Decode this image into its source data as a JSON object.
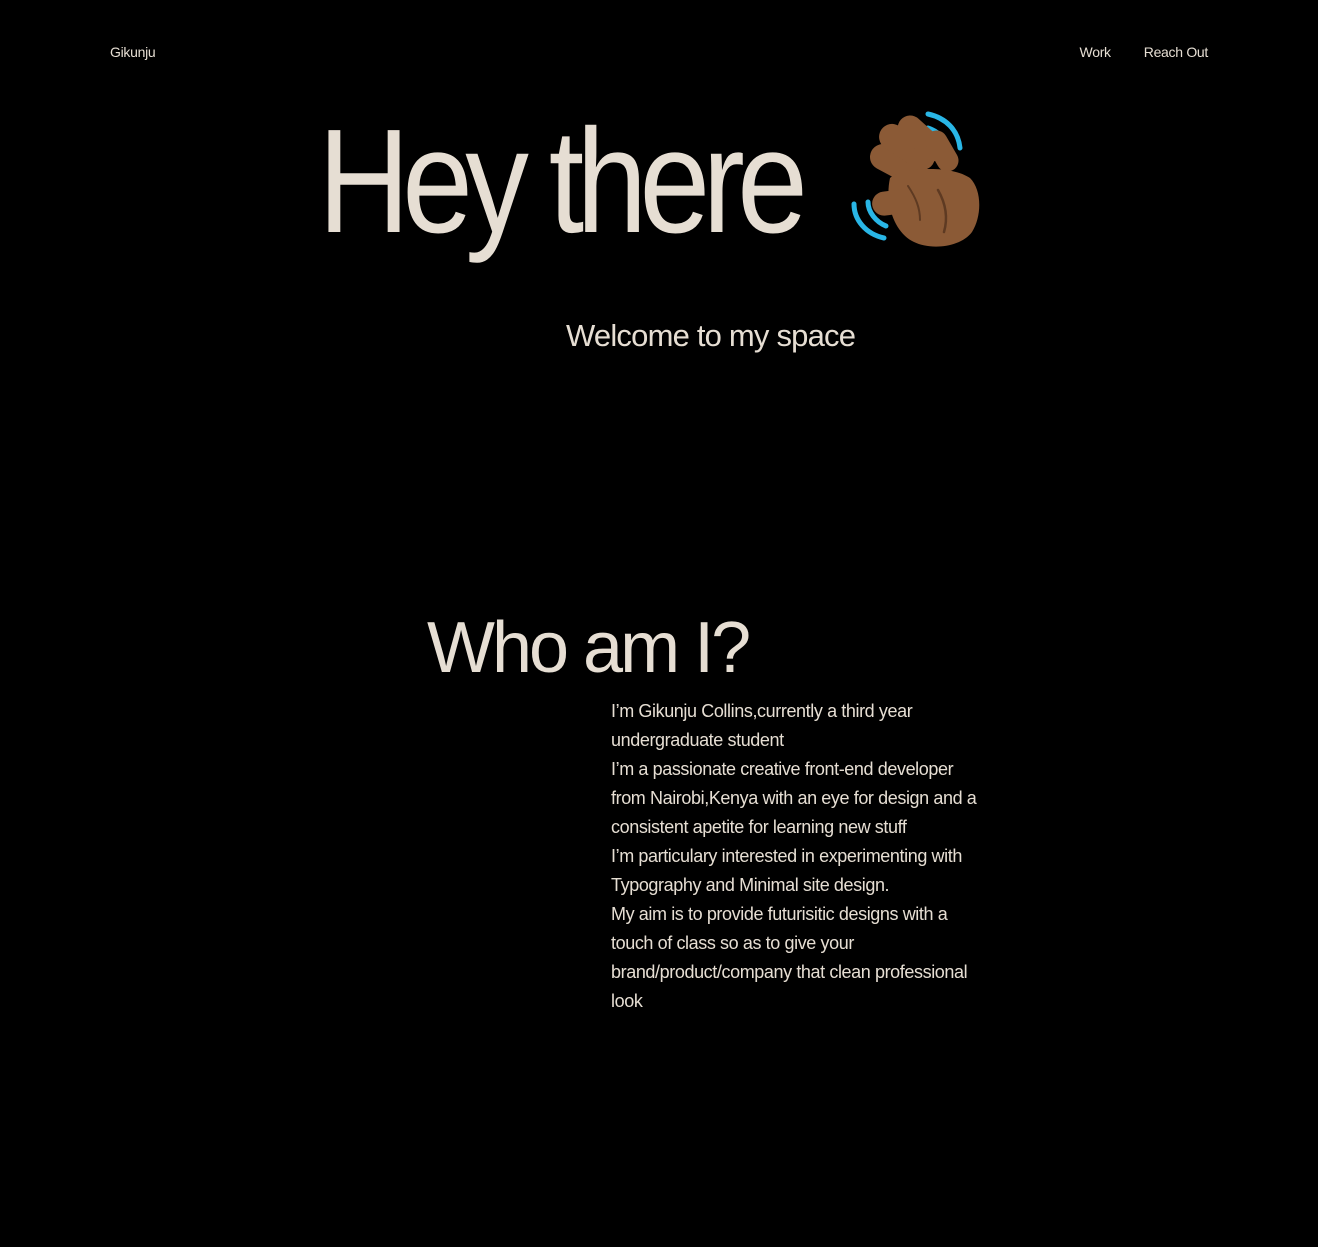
{
  "nav": {
    "brand": "Gikunju",
    "links": [
      {
        "label": "Work"
      },
      {
        "label": "Reach Out"
      }
    ]
  },
  "hero": {
    "title": "Hey there",
    "icon": "waving-hand-icon",
    "subtitle": "Welcome to my space"
  },
  "about": {
    "title": "Who am I?",
    "paragraphs": [
      "I’m Gikunju Collins,currently a third year undergraduate student",
      "I’m a passionate creative front-end developer from Nairobi,Kenya with an eye for design and a consistent apetite for learning new stuff",
      "I’m particulary interested in experimenting with Typography and Minimal site design.",
      "My aim is to provide futurisitic designs with a touch of class so as to give your brand/product/company that clean professional look"
    ]
  },
  "colors": {
    "background": "#000000",
    "text": "#e6ded3",
    "hand": "#8b5a36",
    "wave_lines": "#29b6e6"
  }
}
